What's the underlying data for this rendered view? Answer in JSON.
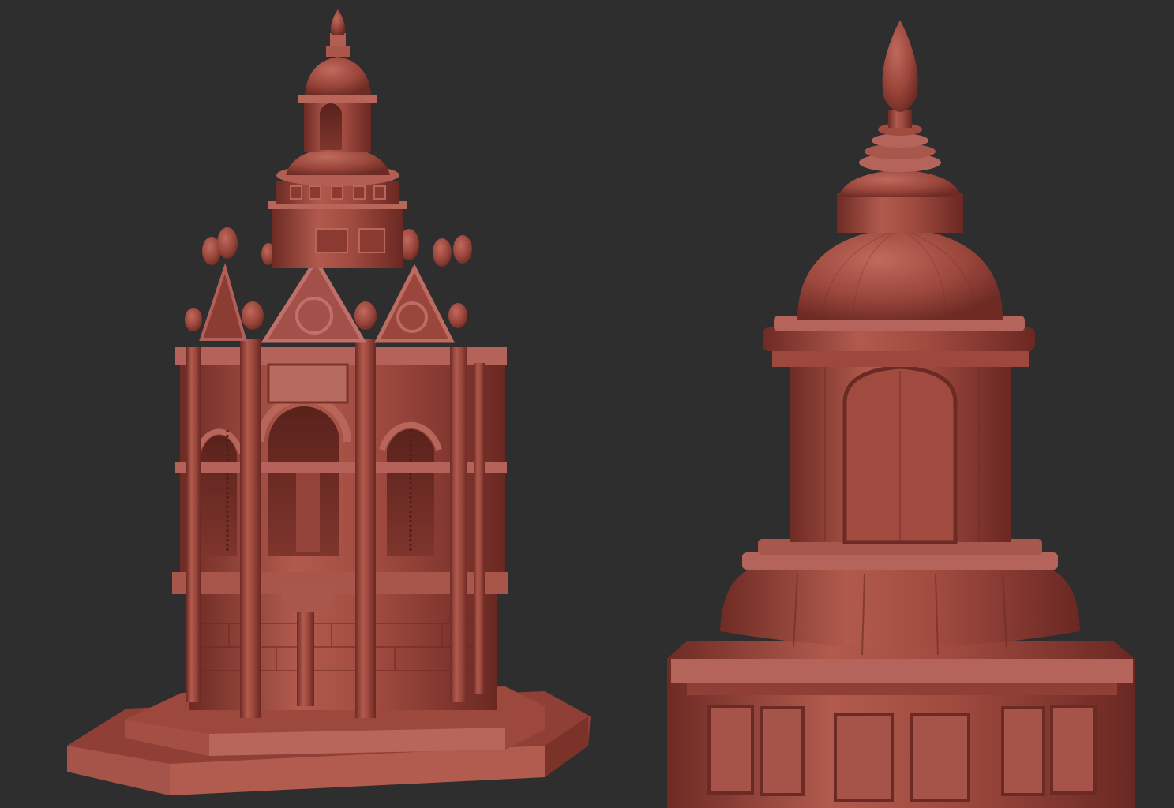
{
  "scene": {
    "background_color": "#2e2e2e",
    "material_color": "#a14b40",
    "material_shadow": "#6e2b24",
    "material_highlight": "#c26a5d",
    "panels": [
      {
        "subject": "fountain-pavilion-full-view"
      },
      {
        "subject": "cupola-closeup-view"
      }
    ]
  }
}
